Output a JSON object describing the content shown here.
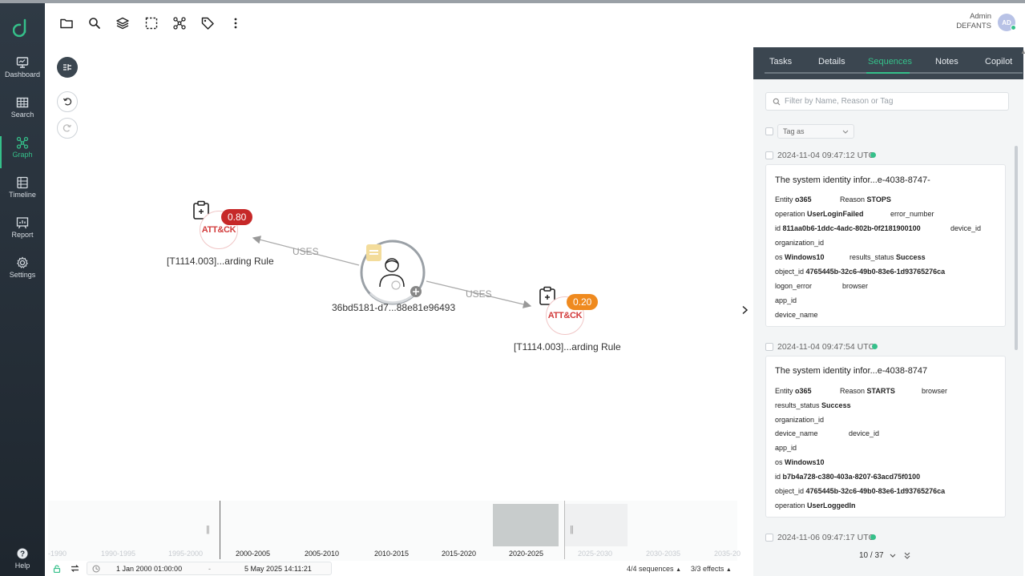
{
  "sidebar": {
    "items": [
      {
        "label": "Dashboard",
        "icon": "monitor-icon"
      },
      {
        "label": "Search",
        "icon": "grid-icon"
      },
      {
        "label": "Graph",
        "icon": "graph-icon"
      },
      {
        "label": "Timeline",
        "icon": "timeline-icon"
      },
      {
        "label": "Report",
        "icon": "report-icon"
      },
      {
        "label": "Settings",
        "icon": "gear-icon"
      }
    ],
    "help_label": "Help"
  },
  "user": {
    "name": "Admin",
    "org": "DEFANTS",
    "initials": "AD"
  },
  "graph": {
    "center_node": {
      "label": "36bd5181-d7...88e81e96493"
    },
    "left_node": {
      "label": "[T1114.003]...arding Rule",
      "score": "0.80",
      "badge": "ATT&CK"
    },
    "right_node": {
      "label": "[T1114.003]...arding Rule",
      "score": "0.20",
      "badge": "ATT&CK"
    },
    "edge_label_left": "USES",
    "edge_label_right": "USES",
    "colors": {
      "high": "#c62828",
      "medium": "#ef8a1f",
      "accent": "#35c08a"
    }
  },
  "timeline": {
    "ticks": [
      {
        "label": "-1990",
        "faded": true
      },
      {
        "label": "1990-1995",
        "faded": true
      },
      {
        "label": "1995-2000",
        "faded": true
      },
      {
        "label": "2000-2005",
        "faded": false
      },
      {
        "label": "2005-2010",
        "faded": false
      },
      {
        "label": "2010-2015",
        "faded": false
      },
      {
        "label": "2015-2020",
        "faded": false
      },
      {
        "label": "2020-2025",
        "faded": false
      },
      {
        "label": "2025-2030",
        "faded": true
      },
      {
        "label": "2030-2035",
        "faded": true
      },
      {
        "label": "2035-20",
        "faded": true
      }
    ],
    "start": "1 Jan 2000 01:00:00",
    "separator": "-",
    "end": "5 May 2025 14:11:21",
    "sequences": "4/4 sequences",
    "effects": "3/3 effects"
  },
  "panel": {
    "tabs": [
      "Tasks",
      "Details",
      "Sequences",
      "Notes",
      "Copilot"
    ],
    "active_tab": "Sequences",
    "filter_placeholder": "Filter by Name, Reason or Tag",
    "tag_as": "Tag as",
    "sequences": [
      {
        "time": "2024-11-04 09:47:12 UTC",
        "title": "The system identity infor...e-4038-8747-",
        "rows": [
          [
            {
              "k": "Entity",
              "v": "o365"
            },
            {
              "k": "Reason",
              "v": "STOPS"
            }
          ],
          [
            {
              "k": "operation",
              "v": "UserLoginFailed"
            },
            {
              "k": "error_number",
              "v": ""
            }
          ],
          [
            {
              "k": "id",
              "v": "811aa0b6-1ddc-4adc-802b-0f2181900100"
            },
            {
              "k": "device_id",
              "v": ""
            }
          ],
          [
            {
              "k": "organization_id",
              "v": ""
            }
          ],
          [
            {
              "k": "os",
              "v": "Windows10"
            },
            {
              "k": "results_status",
              "v": "Success"
            }
          ],
          [
            {
              "k": "object_id",
              "v": "4765445b-32c6-49b0-83e6-1d93765276ca"
            }
          ],
          [
            {
              "k": "logon_error",
              "v": ""
            },
            {
              "k": "browser",
              "v": ""
            }
          ],
          [
            {
              "k": "app_id",
              "v": ""
            }
          ],
          [
            {
              "k": "device_name",
              "v": ""
            }
          ]
        ]
      },
      {
        "time": "2024-11-04 09:47:54 UTC",
        "title": "The system identity infor...e-4038-8747",
        "rows": [
          [
            {
              "k": "Entity",
              "v": "o365"
            },
            {
              "k": "Reason",
              "v": "STARTS"
            },
            {
              "k": "browser",
              "v": ""
            }
          ],
          [
            {
              "k": "results_status",
              "v": "Success"
            }
          ],
          [
            {
              "k": "organization_id",
              "v": ""
            }
          ],
          [
            {
              "k": "device_name",
              "v": ""
            },
            {
              "k": "device_id",
              "v": ""
            }
          ],
          [
            {
              "k": "app_id",
              "v": ""
            }
          ],
          [
            {
              "k": "os",
              "v": "Windows10"
            }
          ],
          [
            {
              "k": "id",
              "v": "b7b4a728-c380-403a-8207-63acd75f0100"
            }
          ],
          [
            {
              "k": "object_id",
              "v": "4765445b-32c6-49b0-83e6-1d93765276ca"
            }
          ],
          [
            {
              "k": "operation",
              "v": "UserLoggedIn"
            }
          ]
        ]
      },
      {
        "time": "2024-11-06 09:47:17 UTC"
      }
    ],
    "pager": "10 / 37"
  }
}
